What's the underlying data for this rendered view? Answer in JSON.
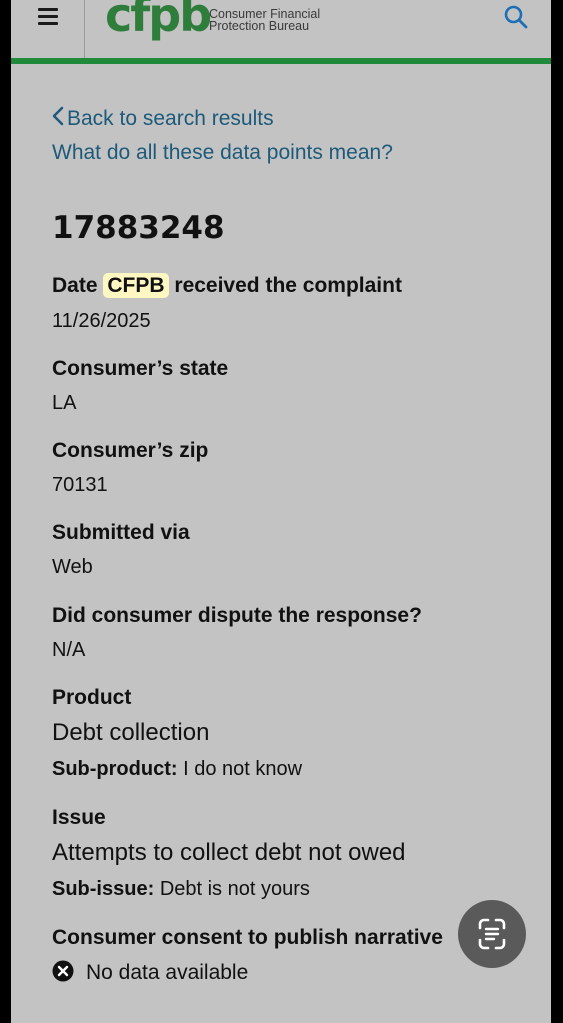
{
  "header": {
    "logo_mark": "cfpb",
    "logo_line1": "Consumer Financial",
    "logo_line2": "Protection Bureau",
    "icons": {
      "menu": "hamburger-menu-icon",
      "search": "search-icon"
    },
    "colors": {
      "brand_green": "#2f7d3a",
      "bar_green": "#1f8b3a",
      "link_blue": "#1d5a7a"
    }
  },
  "nav": {
    "back_label": "Back to search results",
    "help_label": "What do all these data points mean?"
  },
  "complaint": {
    "id": "17883248",
    "date_label_pre": "Date",
    "date_label_hl": "CFPB",
    "date_label_post": "received the complaint",
    "date_value": "11/26/2025",
    "state_label": "Consumer’s state",
    "state_value": "LA",
    "zip_label": "Consumer’s zip",
    "zip_value": "70131",
    "submitted_label": "Submitted via",
    "submitted_value": "Web",
    "dispute_label": "Did consumer dispute the response?",
    "dispute_value": "N/A",
    "product_label": "Product",
    "product_value": "Debt collection",
    "subproduct_label": "Sub-product:",
    "subproduct_value": "I do not know",
    "issue_label": "Issue",
    "issue_value": "Attempts to collect debt not owed",
    "subissue_label": "Sub-issue:",
    "subissue_value": "Debt is not yours",
    "consent_label": "Consumer consent to publish narrative",
    "consent_value": "No data available"
  }
}
